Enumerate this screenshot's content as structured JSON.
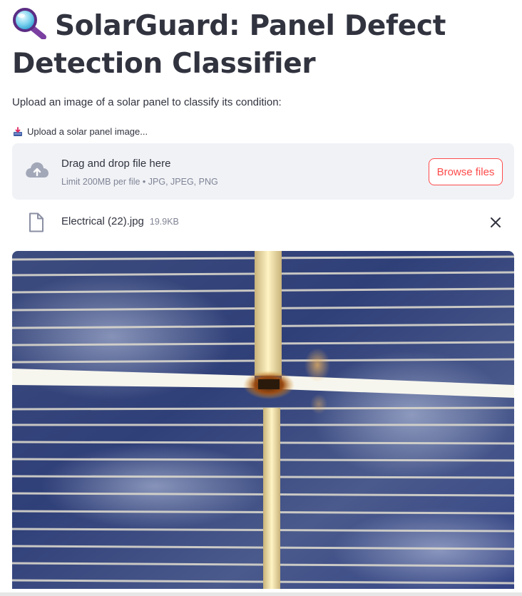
{
  "header": {
    "title_line1": "SolarGuard: Panel Defect",
    "title_line2": "Detection Classifier",
    "title_icon": "magnifying-glass-icon"
  },
  "intro": {
    "text": "Upload an image of a solar panel to classify its condition:"
  },
  "uploader": {
    "label": "Upload a solar panel image...",
    "label_icon": "inbox-tray-icon",
    "drop_text": "Drag and drop file here",
    "limit_text": "Limit 200MB per file • JPG, JPEG, PNG",
    "browse_label": "Browse files",
    "accent_color": "#ff4b4b"
  },
  "uploaded_file": {
    "name": "Electrical (22).jpg",
    "size": "19.9KB",
    "icon": "file-icon"
  },
  "preview": {
    "subject": "solar panel close-up",
    "icon": "uploaded-image"
  }
}
